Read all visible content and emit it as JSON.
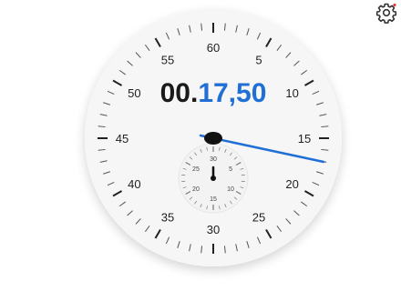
{
  "settings": {
    "icon": "gear-icon"
  },
  "stopwatch": {
    "elapsed_minutes": "00.",
    "elapsed_seconds": "17,50",
    "main_dial_labels": [
      "5",
      "10",
      "15",
      "20",
      "25",
      "30",
      "35",
      "40",
      "45",
      "50",
      "55",
      "60"
    ],
    "sub_dial_labels": [
      "5",
      "10",
      "15",
      "20",
      "25",
      "30"
    ]
  },
  "colors": {
    "accent": "#1f6fd6",
    "dial_face": "#f6f6f6",
    "text_dark": "#1a1a1a"
  }
}
